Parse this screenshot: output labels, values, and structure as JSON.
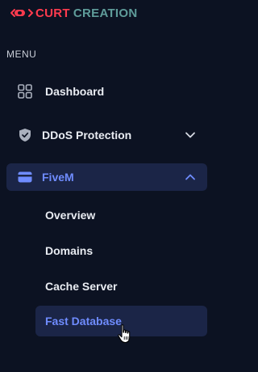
{
  "brand": {
    "word1": "CURT",
    "word2": "CREATION",
    "colors": {
      "accent": "#ff3b4e",
      "secondary": "#5f9c9a"
    }
  },
  "menu": {
    "label": "MENU",
    "items": [
      {
        "label": "Dashboard",
        "icon": "grid-icon"
      },
      {
        "label": "DDoS Protection",
        "icon": "shield-icon",
        "chevron": "down"
      },
      {
        "label": "FiveM",
        "icon": "card-icon",
        "chevron": "up",
        "active": true,
        "children": [
          {
            "label": "Overview"
          },
          {
            "label": "Domains"
          },
          {
            "label": "Cache Server"
          },
          {
            "label": "Fast Database",
            "active": true
          }
        ]
      }
    ]
  },
  "colors": {
    "background": "#0c1222",
    "active_bg": "#1b2547",
    "active_text": "#6f8cff"
  }
}
